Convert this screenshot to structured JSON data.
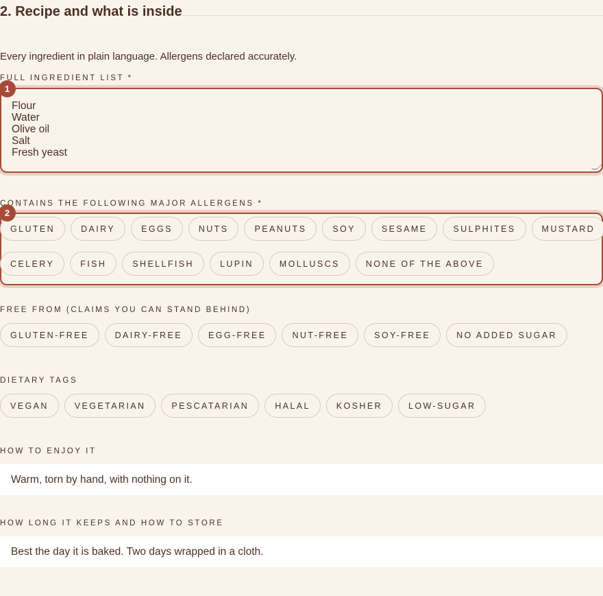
{
  "section": {
    "title": "2. Recipe and what is inside",
    "intro": "Every ingredient in plain language. Allergens declared accurately."
  },
  "ingredients": {
    "label": "Full ingredient list *",
    "value": "Flour\nWater\nOlive oil\nSalt\nFresh yeast",
    "badge": "1"
  },
  "allergens": {
    "label": "Contains the following major allergens *",
    "badge": "2",
    "row1": [
      "Gluten",
      "Dairy",
      "Eggs",
      "Nuts",
      "Peanuts",
      "Soy",
      "Sesame",
      "Sulphites",
      "Mustard"
    ],
    "row2": [
      "Celery",
      "Fish",
      "Shellfish",
      "Lupin",
      "Molluscs",
      "None of the above"
    ]
  },
  "free_from": {
    "label": "Free from (claims you can stand behind)",
    "items": [
      "Gluten-free",
      "Dairy-free",
      "Egg-free",
      "Nut-free",
      "Soy-free",
      "No added sugar"
    ]
  },
  "dietary": {
    "label": "Dietary tags",
    "items": [
      "Vegan",
      "Vegetarian",
      "Pescatarian",
      "Halal",
      "Kosher",
      "Low-sugar"
    ]
  },
  "enjoy": {
    "label": "How to enjoy it",
    "value": "Warm, torn by hand, with nothing on it."
  },
  "storage": {
    "label": "How long it keeps and how to store",
    "value": "Best the day it is baked. Two days wrapped in a cloth."
  },
  "colors": {
    "accent": "#a64b3a",
    "text": "#4a2f24",
    "background": "#f8f4ec"
  }
}
